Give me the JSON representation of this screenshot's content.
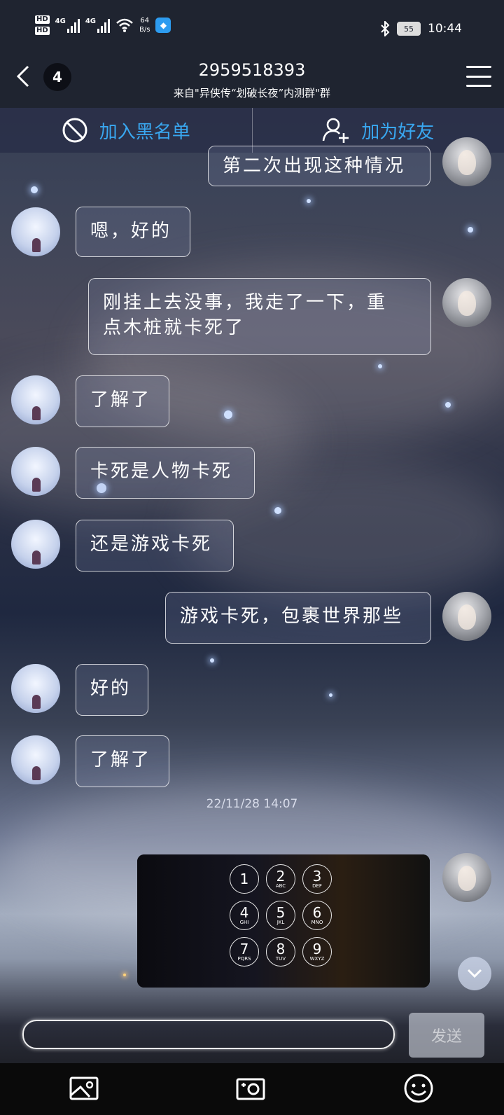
{
  "status_bar": {
    "hd1": "HD",
    "hd2": "HD",
    "sim1": "4G",
    "sim2": "4G",
    "net_speed_value": "64",
    "net_speed_unit": "B/s",
    "battery": "55",
    "time": "10:44"
  },
  "header": {
    "unread_count": "4",
    "title": "2959518393",
    "subtitle": "来自\"异侠传“划破长夜”内测群\"群"
  },
  "actions": {
    "blacklist_label": "加入黑名单",
    "add_friend_label": "加为好友"
  },
  "messages": [
    {
      "from": "me",
      "text": "第二次出现这种情况"
    },
    {
      "from": "other",
      "text": "嗯，好的"
    },
    {
      "from": "me",
      "line1": "刚挂上去没事，我走了一下，重",
      "line2": "点木桩就卡死了"
    },
    {
      "from": "other",
      "text": "了解了"
    },
    {
      "from": "other",
      "text": "卡死是人物卡死"
    },
    {
      "from": "other",
      "text": "还是游戏卡死"
    },
    {
      "from": "me",
      "text": "游戏卡死，包裹世界那些"
    },
    {
      "from": "other",
      "text": "好的"
    },
    {
      "from": "other",
      "text": "了解了"
    }
  ],
  "timestamp": "22/11/28  14:07",
  "keypad": [
    {
      "d": "1",
      "l": ""
    },
    {
      "d": "2",
      "l": "ABC"
    },
    {
      "d": "3",
      "l": "DEF"
    },
    {
      "d": "4",
      "l": "GHI"
    },
    {
      "d": "5",
      "l": "JKL"
    },
    {
      "d": "6",
      "l": "MNO"
    },
    {
      "d": "7",
      "l": "PQRS"
    },
    {
      "d": "8",
      "l": "TUV"
    },
    {
      "d": "9",
      "l": "WXYZ"
    }
  ],
  "composer": {
    "send_label": "发送"
  },
  "colors": {
    "accent": "#39a7f0",
    "bar_bg": "#1f2430"
  }
}
